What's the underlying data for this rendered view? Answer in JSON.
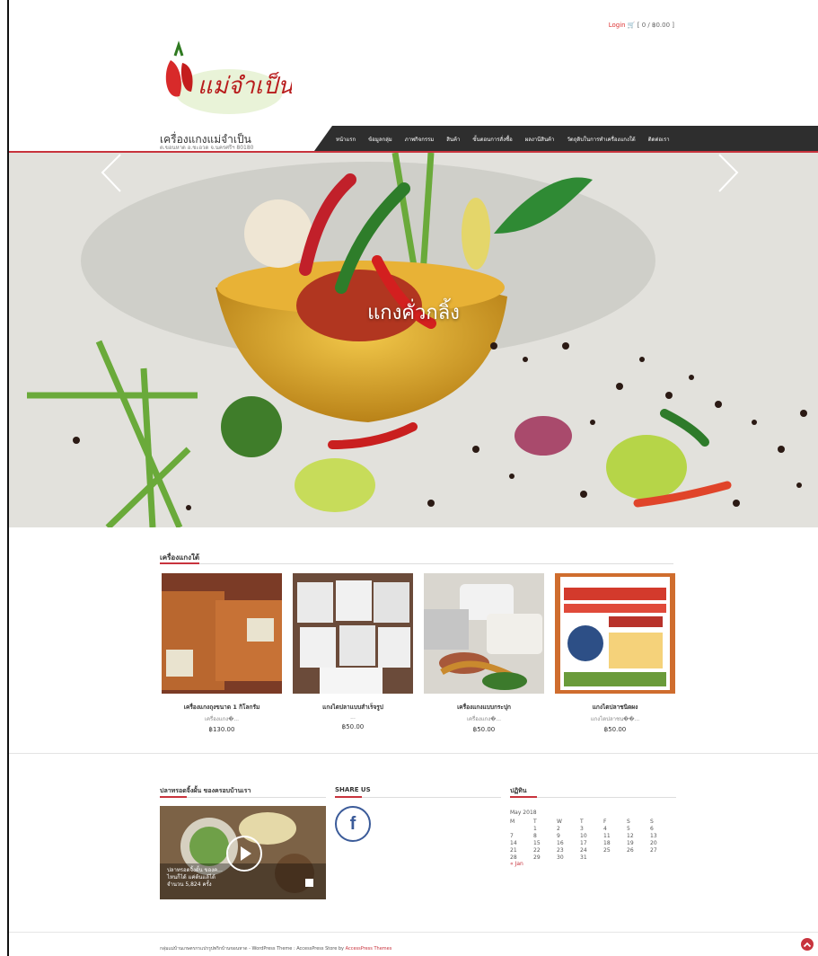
{
  "header": {
    "login_label": "Login",
    "cart_text": "[ 0 / ฿0.00 ]",
    "site_title": "เครื่องแกงแม่จำเป็น",
    "site_subtitle": "ต.ขอนหาด อ.ชะอวด จ.นครศรีฯ 80180"
  },
  "nav": {
    "items": [
      "หน้าแรก",
      "ข้อมูลกลุ่ม",
      "ภาพกิจกรรม",
      "สินค้า",
      "ขั้นตอนการสั่งซื้อ",
      "ผลงานีสินค้า",
      "วัตถุดิบในการทำเครื่องแกงใต้",
      "ติดต่อเรา"
    ]
  },
  "slider": {
    "caption": "แกงคั่วกลิ้ง"
  },
  "products_section": {
    "title": "เครื่องแกงใต้",
    "items": [
      {
        "name": "เครื่องแกงถุงขนาด 1 กิโลกรัม",
        "desc": "เครื่องแกง�...",
        "price": "฿130.00"
      },
      {
        "name": "แกงไตปลาแบบสำเร็จรูป",
        "desc": "...",
        "price": "฿50.00"
      },
      {
        "name": "เครื่องแกงแบบกระปุก",
        "desc": "เครื่องแกง�...",
        "price": "฿50.00"
      },
      {
        "name": "แกงไตปลาชนิดผง",
        "desc": "แกงไตปลาชน��...",
        "price": "฿50.00"
      }
    ]
  },
  "widgets": {
    "video_title": "ปลาทรอดจิ้งผั้น ของครอบบ้านเรา",
    "video_caption_line1": "ปลาทรอดจิ้งผั้น ของค...",
    "video_caption_line2": "ไหนก็ได้ แค่ต้นแล้ได้",
    "video_caption_line3": "จำนวน 5,824 ครั้ง",
    "share_title": "SHARE US",
    "calendar_title": "ปฏิทิน",
    "calendar_month": "May 2018",
    "calendar_headers": [
      "M",
      "T",
      "W",
      "T",
      "F",
      "S",
      "S"
    ],
    "calendar_rows": [
      [
        "",
        "1",
        "2",
        "3",
        "4",
        "5",
        "6"
      ],
      [
        "7",
        "8",
        "9",
        "10",
        "11",
        "12",
        "13"
      ],
      [
        "14",
        "15",
        "16",
        "17",
        "18",
        "19",
        "20"
      ],
      [
        "21",
        "22",
        "23",
        "24",
        "25",
        "26",
        "27"
      ],
      [
        "28",
        "29",
        "30",
        "31",
        "",
        "",
        ""
      ]
    ],
    "calendar_prev": "« Jan"
  },
  "footer": {
    "text": "กลุ่มแม่บ้านเกษตรกรแปรรูปพริกบ้านขอนหาด - WordPress Theme : AccessPress Store by ",
    "link": "AccessPress Themes"
  },
  "colors": {
    "accent": "#c8333d",
    "nav_bg": "#2e2e2e",
    "facebook": "#3b5b99"
  }
}
